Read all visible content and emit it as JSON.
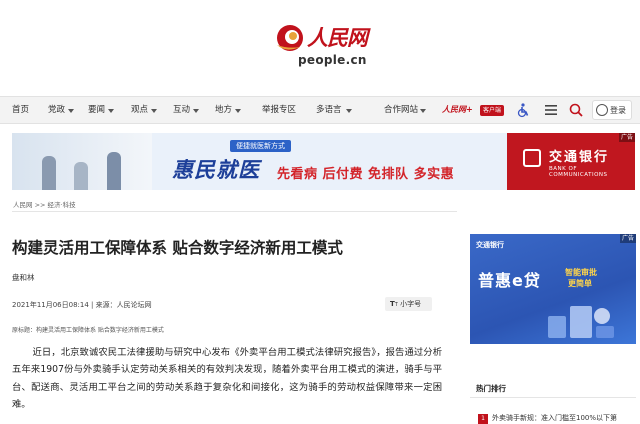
{
  "site": {
    "logo_cn": "人民网",
    "logo_en": "people.cn",
    "brand_color": "#c1121c"
  },
  "nav": {
    "items": [
      {
        "label": "首页",
        "has_dropdown": false
      },
      {
        "label": "党政",
        "has_dropdown": true
      },
      {
        "label": "要闻",
        "has_dropdown": true
      },
      {
        "label": "观点",
        "has_dropdown": true
      },
      {
        "label": "互动",
        "has_dropdown": true
      },
      {
        "label": "地方",
        "has_dropdown": true
      },
      {
        "label": "举报专区",
        "has_dropdown": false
      },
      {
        "label": "多语言",
        "has_dropdown": true
      },
      {
        "label": "合作网站",
        "has_dropdown": true
      }
    ],
    "app_logo": "人民网+",
    "app_badge": "客户端",
    "accessibility_icon": "wheelchair-icon",
    "menu_icon": "menu-icon",
    "search_icon": "search-icon",
    "login_label": "登录"
  },
  "banner_ad": {
    "subtitle": "便捷就医新方式",
    "title": "惠民就医",
    "slogan": "先看病 后付费 免排队 多实惠",
    "bank_name": "交通银行",
    "bank_en": "BANK OF COMMUNICATIONS",
    "ad_tag": "广告"
  },
  "breadcrumb": "人民网 >> 经济·科技",
  "article": {
    "title": "构建灵活用工保障体系 贴合数字经济新用工模式",
    "author": "盘和林",
    "meta": "2021年11月06日08:14 | 来源：人民论坛网",
    "font_size_label": "小字号",
    "source_line": "原标题：构建灵活用工保障体系 贴合数字经济新用工模式",
    "paragraph": "近日，北京致诚农民工法律援助与研究中心发布《外卖平台用工模式法律研究报告》，报告通过分析五年来1907份与外卖骑手认定劳动关系相关的有效判决发现，随着外卖平台用工模式的演进，骑手与平台、配送商、灵活用工平台之间的劳动关系趋于复杂化和间接化，这为骑手的劳动权益保障带来一定困难。"
  },
  "side_ad": {
    "bank": "交通银行",
    "headline": "普惠e贷",
    "tag1": "智能审批",
    "tag2": "更简单",
    "ad_tag": "广告"
  },
  "ranking": {
    "title": "热门排行",
    "items": [
      {
        "rank": "1",
        "text": "外卖骑手新规：准入门槛至100%以下第"
      }
    ]
  }
}
